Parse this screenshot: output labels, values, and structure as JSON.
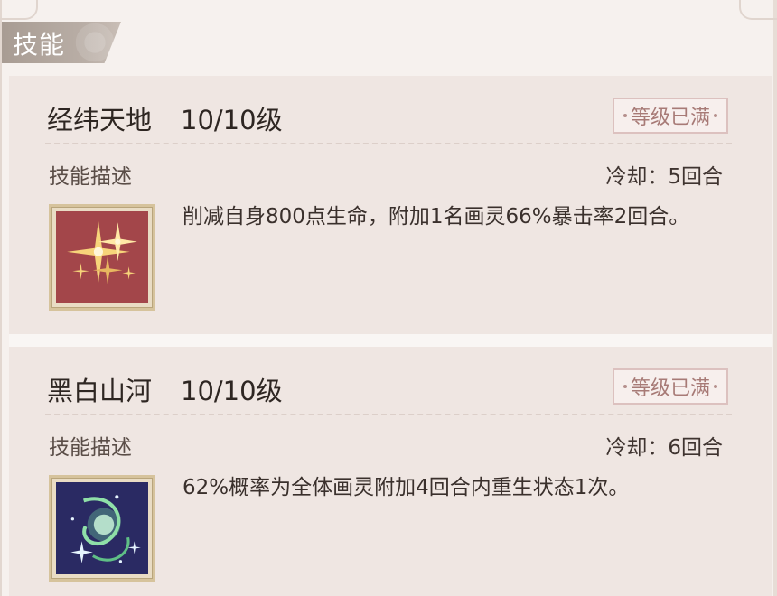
{
  "section": {
    "title": "技能"
  },
  "skills": [
    {
      "name": "经纬天地",
      "level": "10/10级",
      "badge": "等级已满",
      "desc_label": "技能描述",
      "cooldown": "冷却：5回合",
      "description": "削减自身800点生命，附加1名画灵66%暴击率2回合。",
      "icon": "golden-sparkle-icon"
    },
    {
      "name": "黑白山河",
      "level": "10/10级",
      "badge": "等级已满",
      "desc_label": "技能描述",
      "cooldown": "冷却：6回合",
      "description": "62%概率为全体画灵附加4回合内重生状态1次。",
      "icon": "green-spiral-orb-icon"
    }
  ],
  "colors": {
    "card_bg": "#efe6e2",
    "badge_text": "#a77a76",
    "icon1_bg": "#a3464a",
    "icon2_bg": "#2a2a63"
  }
}
